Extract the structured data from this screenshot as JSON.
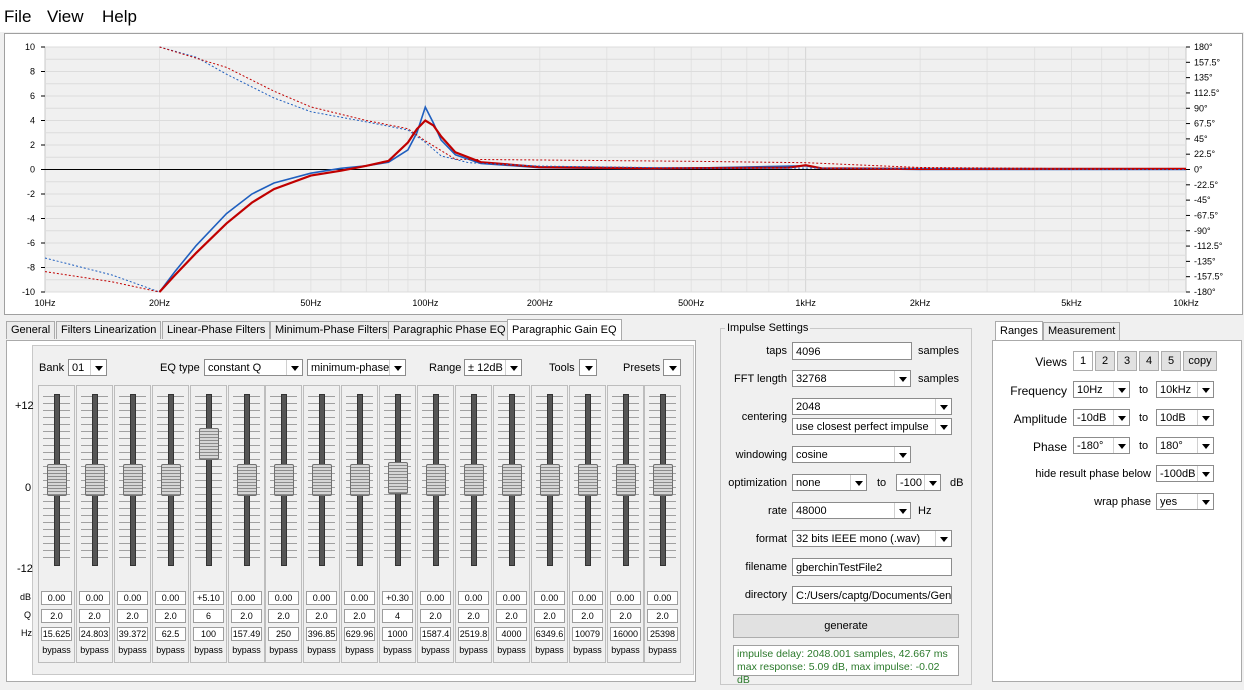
{
  "menu": {
    "items": [
      "File",
      "View",
      "Help"
    ]
  },
  "chart_data": {
    "type": "line",
    "x_scale": "log",
    "xlim": [
      10,
      10000
    ],
    "ylim": [
      -10,
      10
    ],
    "y2lim": [
      -180,
      180
    ],
    "grid": true,
    "x_ticks": [
      "10Hz",
      "20Hz",
      "50Hz",
      "100Hz",
      "200Hz",
      "500Hz",
      "1kHz",
      "2kHz",
      "5kHz",
      "10kHz"
    ],
    "y_ticks": [
      "10",
      "8",
      "6",
      "4",
      "2",
      "0",
      "-2",
      "-4",
      "-6",
      "-8",
      "-10"
    ],
    "y2_ticks": [
      "180°",
      "157.5°",
      "135°",
      "112.5°",
      "90°",
      "67.5°",
      "45°",
      "22.5°",
      "0°",
      "-22.5°",
      "-45°",
      "-67.5°",
      "-90°",
      "-112.5°",
      "-135°",
      "-157.5°",
      "-180°"
    ],
    "series": [
      {
        "role": "target magnitude",
        "color": "#1f5fbf",
        "dash": false,
        "points": [
          [
            20,
            -10
          ],
          [
            22,
            -8.3
          ],
          [
            25,
            -6.2
          ],
          [
            30,
            -3.6
          ],
          [
            35,
            -2
          ],
          [
            40,
            -1.1
          ],
          [
            50,
            -0.3
          ],
          [
            60,
            0.1
          ],
          [
            70,
            0.3
          ],
          [
            80,
            0.6
          ],
          [
            90,
            1.6
          ],
          [
            95,
            3
          ],
          [
            100,
            5.09
          ],
          [
            105,
            3.8
          ],
          [
            110,
            2.4
          ],
          [
            120,
            1.2
          ],
          [
            140,
            0.5
          ],
          [
            200,
            0.15
          ],
          [
            400,
            0.05
          ],
          [
            1000,
            0.3
          ],
          [
            1100,
            0.1
          ],
          [
            2000,
            0
          ],
          [
            10000,
            0
          ]
        ]
      },
      {
        "role": "result magnitude",
        "color": "#c00000",
        "dash": false,
        "points": [
          [
            20,
            -10
          ],
          [
            22,
            -8.6
          ],
          [
            25,
            -6.8
          ],
          [
            30,
            -4.4
          ],
          [
            35,
            -2.7
          ],
          [
            40,
            -1.6
          ],
          [
            50,
            -0.5
          ],
          [
            60,
            -0.1
          ],
          [
            70,
            0.3
          ],
          [
            80,
            0.7
          ],
          [
            90,
            2.2
          ],
          [
            95,
            3.3
          ],
          [
            100,
            4
          ],
          [
            105,
            3.6
          ],
          [
            110,
            2.7
          ],
          [
            120,
            1.4
          ],
          [
            140,
            0.6
          ],
          [
            200,
            0.2
          ],
          [
            400,
            0.1
          ],
          [
            900,
            0.15
          ],
          [
            1000,
            0.35
          ],
          [
            1100,
            0.1
          ],
          [
            2000,
            0.05
          ],
          [
            10000,
            0.05
          ]
        ]
      },
      {
        "role": "target phase",
        "color": "#1f5fbf",
        "dash": true,
        "points": [
          [
            10,
            -130
          ],
          [
            15,
            -155
          ],
          [
            20,
            -180
          ],
          [
            20.01,
            180
          ],
          [
            25,
            165
          ],
          [
            30,
            140
          ],
          [
            40,
            105
          ],
          [
            50,
            85
          ],
          [
            70,
            70
          ],
          [
            90,
            58
          ],
          [
            100,
            40
          ],
          [
            110,
            20
          ],
          [
            130,
            10
          ],
          [
            200,
            5
          ],
          [
            500,
            2
          ],
          [
            1000,
            2
          ],
          [
            10000,
            0
          ]
        ]
      },
      {
        "role": "result phase",
        "color": "#c00000",
        "dash": true,
        "points": [
          [
            10,
            -150
          ],
          [
            15,
            -165
          ],
          [
            20,
            -180
          ],
          [
            20.01,
            180
          ],
          [
            30,
            150
          ],
          [
            40,
            115
          ],
          [
            50,
            92
          ],
          [
            70,
            72
          ],
          [
            90,
            60
          ],
          [
            100,
            42
          ],
          [
            120,
            15
          ],
          [
            200,
            14
          ],
          [
            500,
            12
          ],
          [
            1000,
            10
          ],
          [
            2000,
            3
          ],
          [
            10000,
            0
          ]
        ]
      }
    ]
  },
  "tabs": [
    "General",
    "Filters Linearization",
    "Linear-Phase Filters",
    "Minimum-Phase Filters",
    "Paragraphic Phase EQ",
    "Paragraphic Gain EQ"
  ],
  "eq": {
    "bank_label": "Bank",
    "bank_value": "01",
    "eqtype_label": "EQ type",
    "eqtype_value": "constant Q",
    "phase_value": "minimum-phase",
    "range_label": "Range",
    "range_value": "± 12dB",
    "tools_label": "Tools",
    "presets_label": "Presets",
    "scale_top": "+12",
    "scale_mid": "0",
    "scale_bot": "-12",
    "row_db": "dB",
    "row_q": "Q",
    "row_hz": "Hz",
    "bands": [
      {
        "db": "0.00",
        "q": "2.0",
        "hz": "15.625",
        "gain": 0,
        "bypass": "bypass"
      },
      {
        "db": "0.00",
        "q": "2.0",
        "hz": "24.803",
        "gain": 0,
        "bypass": "bypass"
      },
      {
        "db": "0.00",
        "q": "2.0",
        "hz": "39.372",
        "gain": 0,
        "bypass": "bypass"
      },
      {
        "db": "0.00",
        "q": "2.0",
        "hz": "62.5",
        "gain": 0,
        "bypass": "bypass"
      },
      {
        "db": "+5.10",
        "q": "6",
        "hz": "100",
        "gain": 5.1,
        "bypass": "bypass"
      },
      {
        "db": "0.00",
        "q": "2.0",
        "hz": "157.49",
        "gain": 0,
        "bypass": "bypass"
      },
      {
        "db": "0.00",
        "q": "2.0",
        "hz": "250",
        "gain": 0,
        "bypass": "bypass"
      },
      {
        "db": "0.00",
        "q": "2.0",
        "hz": "396.85",
        "gain": 0,
        "bypass": "bypass"
      },
      {
        "db": "0.00",
        "q": "2.0",
        "hz": "629.96",
        "gain": 0,
        "bypass": "bypass"
      },
      {
        "db": "+0.30",
        "q": "4",
        "hz": "1000",
        "gain": 0.3,
        "bypass": "bypass"
      },
      {
        "db": "0.00",
        "q": "2.0",
        "hz": "1587.4",
        "gain": 0,
        "bypass": "bypass"
      },
      {
        "db": "0.00",
        "q": "2.0",
        "hz": "2519.8",
        "gain": 0,
        "bypass": "bypass"
      },
      {
        "db": "0.00",
        "q": "2.0",
        "hz": "4000",
        "gain": 0,
        "bypass": "bypass"
      },
      {
        "db": "0.00",
        "q": "2.0",
        "hz": "6349.6",
        "gain": 0,
        "bypass": "bypass"
      },
      {
        "db": "0.00",
        "q": "2.0",
        "hz": "10079",
        "gain": 0,
        "bypass": "bypass"
      },
      {
        "db": "0.00",
        "q": "2.0",
        "hz": "16000",
        "gain": 0,
        "bypass": "bypass"
      },
      {
        "db": "0.00",
        "q": "2.0",
        "hz": "25398",
        "gain": 0,
        "bypass": "bypass"
      }
    ]
  },
  "impulse": {
    "title": "Impulse Settings",
    "taps_label": "taps",
    "taps_value": "4096",
    "taps_unit": "samples",
    "fft_label": "FFT length",
    "fft_value": "32768",
    "fft_unit": "samples",
    "centering_label": "centering",
    "centering_value": "2048",
    "centering_mode": "use closest perfect impulse",
    "windowing_label": "windowing",
    "windowing_value": "cosine",
    "optimization_label": "optimization",
    "optimization_value": "none",
    "opt_to": "to",
    "opt_db_value": "-100",
    "opt_unit": "dB",
    "rate_label": "rate",
    "rate_value": "48000",
    "rate_unit": "Hz",
    "format_label": "format",
    "format_value": "32 bits IEEE mono (.wav)",
    "filename_label": "filename",
    "filename_value": "gberchinTestFile2",
    "directory_label": "directory",
    "directory_value": "C:/Users/captg/Documents/Gene",
    "generate_label": "generate",
    "status_line1": "impulse delay: 2048.001 samples, 42.667 ms",
    "status_line2": "max response: 5.09 dB, max impulse: -0.02 dB"
  },
  "ranges": {
    "tabs": [
      "Ranges",
      "Measurement"
    ],
    "views_label": "Views",
    "views": [
      "1",
      "2",
      "3",
      "4",
      "5"
    ],
    "copy_label": "copy",
    "frequency_label": "Frequency",
    "freq_from": "10Hz",
    "freq_to": "10kHz",
    "amplitude_label": "Amplitude",
    "amp_from": "-10dB",
    "amp_to": "10dB",
    "phase_label": "Phase",
    "phase_from": "-180°",
    "phase_to": "180°",
    "to_label": "to",
    "hide_label": "hide result phase below",
    "hide_value": "-100dB",
    "wrap_label": "wrap phase",
    "wrap_value": "yes"
  }
}
